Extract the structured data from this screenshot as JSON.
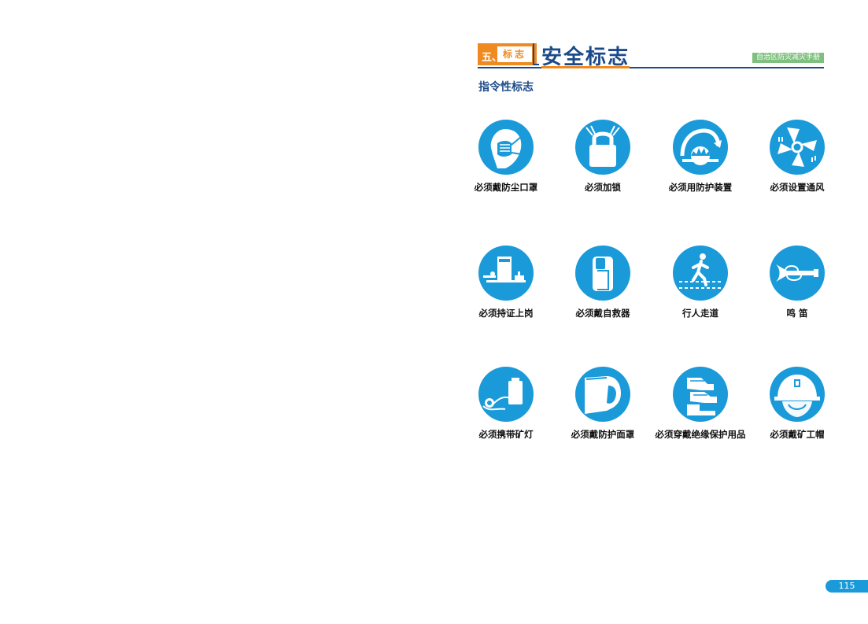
{
  "header": {
    "section_number": "五、",
    "section_word": "标志",
    "title": "安全标志",
    "handbook": "自治区防灾减灾手册"
  },
  "subtitle": "指令性标志",
  "colors": {
    "sign_blue": "#1a9ad9",
    "title_blue": "#1b4a8a",
    "accent_orange": "#ee8a1f",
    "tag_green": "#7fbf7f"
  },
  "signs": [
    {
      "label": "必须戴防尘口罩",
      "icon": "dust-mask-icon"
    },
    {
      "label": "必须加锁",
      "icon": "padlock-icon"
    },
    {
      "label": "必须用防护装置",
      "icon": "saw-guard-icon"
    },
    {
      "label": "必须设置通风",
      "icon": "ventilation-fan-icon"
    },
    {
      "label": "必须持证上岗",
      "icon": "certificate-desk-icon"
    },
    {
      "label": "必须戴自救器",
      "icon": "self-rescuer-icon"
    },
    {
      "label": "行人走道",
      "icon": "pedestrian-walkway-icon"
    },
    {
      "label": "鸣 笛",
      "icon": "horn-icon"
    },
    {
      "label": "必须携带矿灯",
      "icon": "miner-lamp-icon"
    },
    {
      "label": "必须戴防护面罩",
      "icon": "face-shield-icon"
    },
    {
      "label": "必须穿戴绝缘保护用品",
      "icon": "insulated-gloves-boots-icon"
    },
    {
      "label": "必须戴矿工帽",
      "icon": "miner-helmet-icon"
    }
  ],
  "page_number": "115"
}
